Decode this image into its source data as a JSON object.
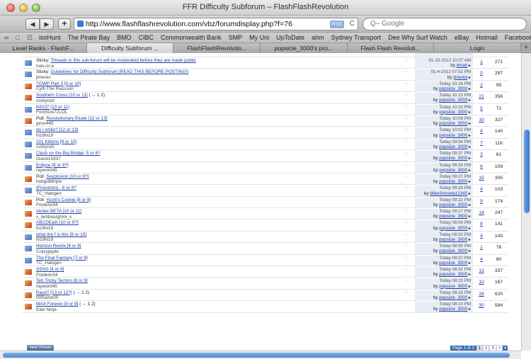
{
  "window": {
    "title": "FFR Difficulty Subforum – FlashFlashRevolution"
  },
  "toolbar": {
    "back": "◀",
    "forward": "▶",
    "new_tab": "+",
    "url": "http://www.flashflashrevolution.com/vbz/forumdisplay.php?f=76",
    "rss": "RSS",
    "reload": "C",
    "search_placeholder": "Q– Google"
  },
  "bookmarks": {
    "icons": [
      "∞",
      "□",
      "☷"
    ],
    "items": [
      "isoHunt",
      "The Pirate Bay",
      "BMO",
      "CIBC",
      "Commonwealth Bank",
      "SMP",
      "My Uni",
      "UpToDate",
      "ahm",
      "Sydney Transport",
      "Dee Why Surf Watch",
      "eBay",
      "Hotmail",
      "Facebook"
    ]
  },
  "tabs": {
    "items": [
      "Level Ranks - FlashF...",
      "Difficulty Subforum ...",
      "FlashFlashRevolutio...",
      "popsicle_3000's pro...",
      "Flash Flash Revoluti...",
      "Login"
    ],
    "active": 1,
    "new_tab": "+"
  },
  "forum": {
    "rows": [
      {
        "icon": "norm",
        "prefix": "",
        "title": "",
        "extra": "",
        "poster": "bmah",
        "date": "",
        "by": "bmah",
        "replies": "",
        "views": "",
        "partial": true
      },
      {
        "icon": "norm",
        "prefix": "Sticky:",
        "title": "Threads in this sub-forum will be moderated before they are made public",
        "extra": "",
        "poster": "nois-or-e",
        "date": "01-10-2012 10:07 AM",
        "by": "bmah",
        "replies": "1",
        "views": "271"
      },
      {
        "icon": "norm",
        "prefix": "Sticky:",
        "title": "Guidelines for Difficulty Subforum [READ THIS BEFORE POSTING!]",
        "extra": "",
        "poster": "jimerex",
        "date": "01-4-2012 07:52 PM",
        "by": "jimerex",
        "replies": "0",
        "views": "287"
      },
      {
        "icon": "hot",
        "prefix": "",
        "title": "TGWP Part 3 [9 or 10]",
        "extra": "",
        "poster": "Cyth The Raccoon",
        "date": "Today 10:16 PM",
        "by": "popsicle_3000",
        "replies": "2",
        "views": "95"
      },
      {
        "icon": "hot",
        "prefix": "",
        "title": "Southern Cross [10 or 11]",
        "extra": "( → 1 2)",
        "poster": "rushyrulz",
        "date": "Today 10:13 PM",
        "by": "popsicle_3000",
        "replies": "21",
        "views": "356"
      },
      {
        "icon": "norm",
        "prefix": "",
        "title": "K8107 [10 or 11]",
        "extra": "",
        "poster": "FontSize72LOL",
        "date": "Today 10:10 PM",
        "by": "popsicle_3000",
        "replies": "5",
        "views": "72"
      },
      {
        "icon": "hot",
        "prefix": "Poll:",
        "title": "Revolutionary Etude [12 or 13]",
        "extra": "",
        "poster": "jprox445",
        "date": "Today 10:06 PM",
        "by": "popsicle_3000",
        "replies": "10",
        "views": "327"
      },
      {
        "icon": "norm",
        "prefix": "",
        "title": "do i smile? [12 or 13]",
        "extra": "",
        "poster": "hi19hi19",
        "date": "Today 10:02 PM",
        "by": "popsicle_3000",
        "replies": "8",
        "views": "140"
      },
      {
        "icon": "norm",
        "prefix": "",
        "title": "101 Kittens [9 or 10]",
        "extra": "",
        "poster": "rushyrulz",
        "date": "Today 09:54 PM",
        "by": "popsicle_3000",
        "replies": "7",
        "views": "116"
      },
      {
        "icon": "norm",
        "prefix": "",
        "title": "Clash on the Big Bridge: 5 or 6?",
        "extra": "",
        "poster": "Guest15937",
        "date": "Today 09:37 PM",
        "by": "popsicle_3000",
        "replies": "3",
        "views": "61"
      },
      {
        "icon": "norm",
        "prefix": "",
        "title": "Eclipse [8 or 9?]",
        "extra": "",
        "poster": "rayword45",
        "date": "Today 09:30 PM",
        "by": "popsicle_3000",
        "replies": "6",
        "views": "109"
      },
      {
        "icon": "hot",
        "prefix": "Poll:",
        "title": "Sexplosion [10 or 9?]",
        "extra": "",
        "poster": "hobgoblinpie",
        "date": "Today 09:27 PM",
        "by": "popsicle_3000",
        "replies": "15",
        "views": "305"
      },
      {
        "icon": "norm",
        "prefix": "",
        "title": "{Firestorm} - 8 or 9?",
        "extra": "",
        "poster": "TC_Halogen",
        "date": "Today 09:26 PM",
        "by": "MikeShinoda12345",
        "replies": "4",
        "views": "103"
      },
      {
        "icon": "hot",
        "prefix": "Poll:",
        "title": "Yoshi's Cookie [8 or 9]",
        "extra": "",
        "poster": "Frederic54",
        "date": "Today 09:22 PM",
        "by": "popsicle_3000",
        "replies": "9",
        "views": "174"
      },
      {
        "icon": "hot",
        "prefix": "",
        "title": "Vertex BETA [10 or 11]",
        "extra": "",
        "poster": "x_lambourghini_x",
        "date": "Today 09:17 PM",
        "by": "popsicle_3000",
        "replies": "14",
        "views": "247"
      },
      {
        "icon": "hot",
        "prefix": "",
        "title": "ABCDEath [10 or 9?]",
        "extra": "",
        "poster": "hi19hi19",
        "date": "Today 09:04 PM",
        "by": "popsicle_3000",
        "replies": "8",
        "views": "141"
      },
      {
        "icon": "norm",
        "prefix": "",
        "title": "what the f is this [9 or 10]",
        "extra": "",
        "poster": "hi19hi19",
        "date": "Today 08:53 PM",
        "by": "popsicle_3000",
        "replies": "4",
        "views": "143"
      },
      {
        "icon": "norm",
        "prefix": "",
        "title": "Horizon Remix [8 or 9]",
        "extra": "",
        "poster": "Crazyjayde",
        "date": "Today 08:50 PM",
        "by": "popsicle_3000",
        "replies": "1",
        "views": "76"
      },
      {
        "icon": "norm",
        "prefix": "",
        "title": "The Final Fantasy [7 or 8]",
        "extra": "",
        "poster": "TC_Halogen",
        "date": "Today 08:37 PM",
        "by": "popsicle_3000",
        "replies": "4",
        "views": "80"
      },
      {
        "icon": "hot",
        "prefix": "",
        "title": "SSSG [4 or 6]",
        "extra": "",
        "poster": "Frederic54",
        "date": "Today 08:32 PM",
        "by": "popsicle_3000",
        "replies": "13",
        "views": "337"
      },
      {
        "icon": "hot",
        "prefix": "",
        "title": "Teh Tricky Techno [8 or 9]",
        "extra": "",
        "poster": "rayword45",
        "date": "Today 08:23 PM",
        "by": "popsicle_3000",
        "replies": "10",
        "views": "167"
      },
      {
        "icon": "hot",
        "prefix": "",
        "title": "Rave? [13 or 12?]",
        "extra": "( → 1 2)",
        "poster": "00Razor00",
        "date": "Today 08:16 PM",
        "by": "popsicle_3000",
        "replies": "28",
        "views": "620"
      },
      {
        "icon": "hot",
        "prefix": "",
        "title": "MAX Forever [8 or 9]",
        "extra": "( → 1 2)",
        "poster": "Elite Ninja",
        "date": "Today 08:10 PM",
        "by": "popsicle_3000",
        "replies": "30",
        "views": "594"
      }
    ]
  },
  "footer": {
    "new_thread": "New Thread",
    "page_label": "Page 1 of 3",
    "pages": [
      "1",
      "2",
      "3",
      ">"
    ],
    "current_page": "1",
    "dropdown": "▾"
  }
}
